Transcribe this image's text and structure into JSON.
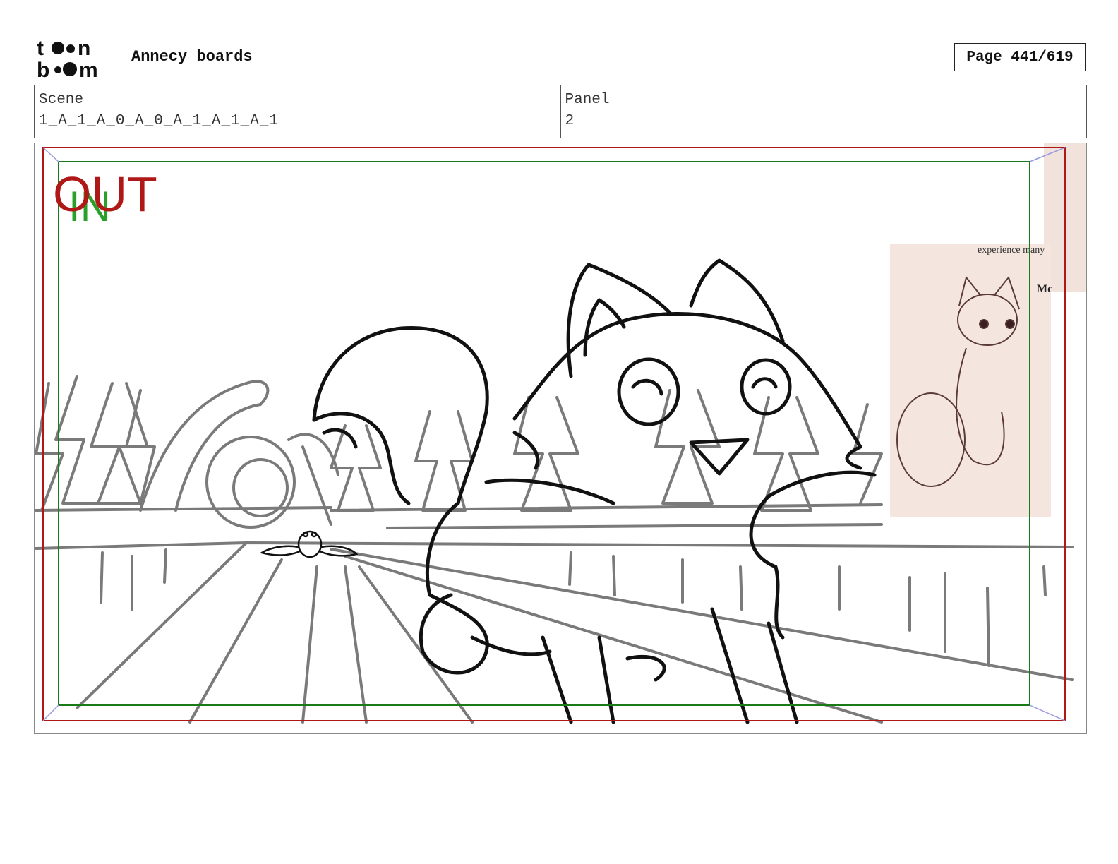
{
  "header": {
    "logo_text": "toon boom",
    "title": "Annecy boards",
    "page_label": "Page 441/619"
  },
  "info": {
    "scene_label": "Scene",
    "scene_value": "1_A_1_A_0_A_0_A_1_A_1_A_1",
    "panel_label": "Panel",
    "panel_value": "2"
  },
  "panel": {
    "safe_out_label": "OUT",
    "safe_in_label": "IN",
    "reference_text": "experience many",
    "reference_text_2": "Mc",
    "colors": {
      "out_frame": "#b01818",
      "in_frame": "#1a7a1a",
      "sketch_bg": "#7a7a7a",
      "sketch_fg": "#111111",
      "reference_paper": "#f4e6df"
    }
  }
}
